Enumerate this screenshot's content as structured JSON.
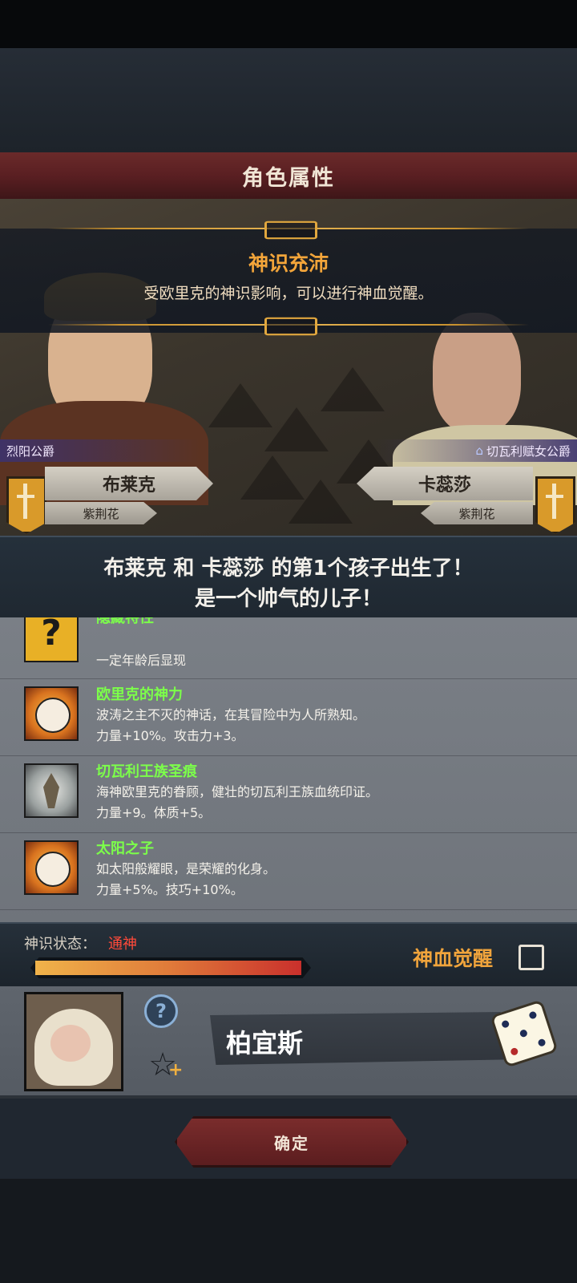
{
  "dialog": {
    "title": "角色属性"
  },
  "notice": {
    "title": "神识充沛",
    "description": "受欧里克的神识影响，可以进行神血觉醒。"
  },
  "father": {
    "title": "烈阳公爵",
    "name": "布莱克",
    "house": "紫荆花"
  },
  "mother": {
    "title": "切瓦利赋女公爵",
    "name": "卡蕊莎",
    "house": "紫荆花"
  },
  "birth_message": {
    "line1": "布莱克 和 卡蕊莎 的第1个孩子出生了！",
    "line2": "是一个帅气的儿子！"
  },
  "traits": [
    {
      "icon": "question-mark-icon",
      "name": "隐藏特性",
      "line1": "",
      "line2": "一定年龄后显现"
    },
    {
      "icon": "smiling-sun-icon",
      "name": "欧里克的神力",
      "line1": "波涛之主不灭的神话，在其冒险中为人所熟知。",
      "line2": "力量+10%。攻击力+3。"
    },
    {
      "icon": "crest-icon",
      "name": "切瓦利王族圣痕",
      "line1": "海神欧里克的眷顾，健壮的切瓦利王族血统印证。",
      "line2": "力量+9。体质+5。"
    },
    {
      "icon": "smiling-sun-icon",
      "name": "太阳之子",
      "line1": "如太阳般耀眼，是荣耀的化身。",
      "line2": "力量+5%。技巧+10%。"
    }
  ],
  "divine": {
    "status_label": "神识状态：",
    "status_value": "通神",
    "progress": 1.0,
    "awaken_label": "神血觉醒",
    "awaken_checked": false
  },
  "child": {
    "name": "柏宜斯"
  },
  "actions": {
    "confirm_label": "确定"
  },
  "colors": {
    "accent_orange": "#f0a43c",
    "trait_green": "#7cff4a",
    "status_red": "#ff4a3a",
    "title_red": "#5a1f22"
  }
}
